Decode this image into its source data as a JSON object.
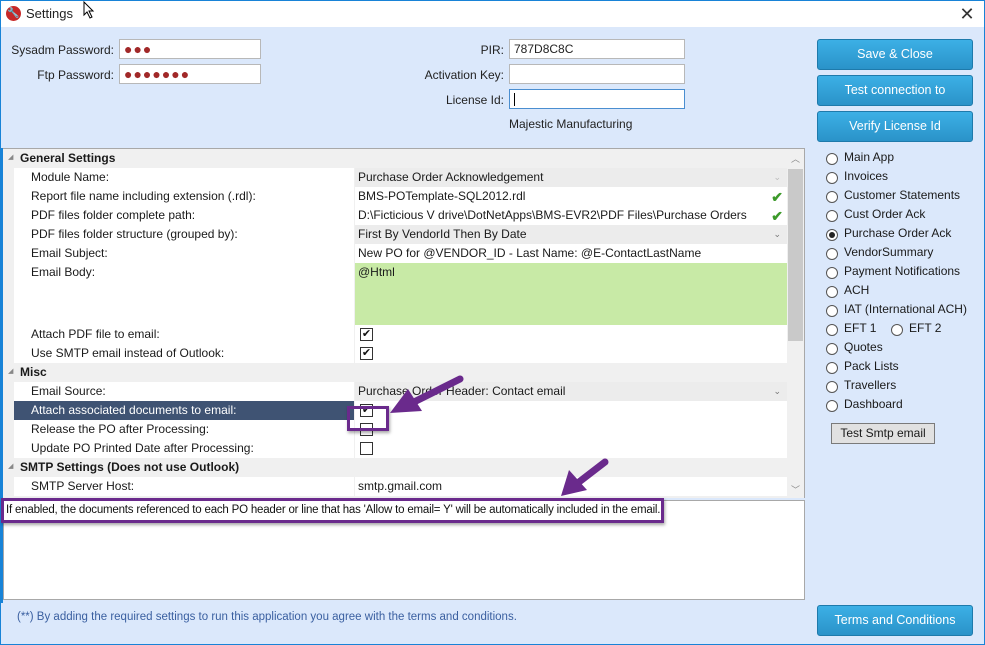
{
  "window": {
    "title": "Settings",
    "close_icon": "close-icon",
    "app_icon": "wrench-icon"
  },
  "credentials": {
    "sysadm_label": "Sysadm Password:",
    "sysadm_value": "●●●",
    "ftp_label": "Ftp Password:",
    "ftp_value": "●●●●●●●",
    "pir_label": "PIR:",
    "pir_value": "787D8C8C",
    "activation_label": "Activation Key:",
    "activation_value": "",
    "license_label": "License Id:",
    "license_value": "",
    "company_name": "Majestic Manufacturing"
  },
  "buttons": {
    "save_close": "Save & Close",
    "test_db": "Test connection to database",
    "verify_license": "Verify License Id",
    "test_smtp": "Test Smtp email",
    "terms": "Terms and Conditions"
  },
  "modules": {
    "selected": "Purchase Order Ack",
    "items": [
      {
        "label": "Main App",
        "checked": false
      },
      {
        "label": "Invoices",
        "checked": false
      },
      {
        "label": "Customer Statements",
        "checked": false
      },
      {
        "label": "Cust Order Ack",
        "checked": false
      },
      {
        "label": "Purchase Order Ack",
        "checked": true
      },
      {
        "label": "VendorSummary",
        "checked": false
      },
      {
        "label": "Payment Notifications",
        "checked": false
      },
      {
        "label": "ACH",
        "checked": false
      },
      {
        "label": "IAT (International ACH)",
        "checked": false
      },
      {
        "label": "EFT 1",
        "checked": false
      },
      {
        "label": "EFT 2",
        "checked": false
      },
      {
        "label": "Quotes",
        "checked": false
      },
      {
        "label": "Pack Lists",
        "checked": false
      },
      {
        "label": "Travellers",
        "checked": false
      },
      {
        "label": "Dashboard",
        "checked": false
      }
    ]
  },
  "property_grid": {
    "categories": [
      {
        "name": "General Settings",
        "rows": [
          {
            "label": "Module Name:",
            "value": "Purchase Order Acknowledgement",
            "type": "combo-disabled"
          },
          {
            "label": "Report file name including extension (.rdl):",
            "value": "BMS-POTemplate-SQL2012.rdl",
            "type": "validated"
          },
          {
            "label": "PDF files folder complete path:",
            "value": "D:\\Ficticious V drive\\DotNetApps\\BMS-EVR2\\PDF Files\\Purchase Orders",
            "type": "validated"
          },
          {
            "label": "PDF files folder structure (grouped by):",
            "value": "First By VendorId Then By Date",
            "type": "combo"
          },
          {
            "label": "Email Subject:",
            "value": "New PO for @VENDOR_ID - Last Name:  @E-ContactLastName",
            "type": "text"
          },
          {
            "label": "Email Body:",
            "value": "@Html",
            "type": "multiline"
          },
          {
            "label": "Attach PDF file to email:",
            "checked": true,
            "type": "checkbox"
          },
          {
            "label": "Use SMTP email instead of Outlook:",
            "checked": true,
            "type": "checkbox"
          }
        ]
      },
      {
        "name": "Misc",
        "rows": [
          {
            "label": "Email Source:",
            "value": "Purchase Order Header: Contact email",
            "type": "combo"
          },
          {
            "label": "Attach associated documents to email:",
            "checked": true,
            "type": "checkbox",
            "selected": true
          },
          {
            "label": "Release the PO after Processing:",
            "checked": false,
            "type": "checkbox"
          },
          {
            "label": "Update PO Printed Date after Processing:",
            "checked": false,
            "type": "checkbox"
          }
        ]
      },
      {
        "name": "SMTP Settings (Does not use Outlook)",
        "rows": [
          {
            "label": "SMTP Server Host:",
            "value": "smtp.gmail.com",
            "type": "text"
          }
        ]
      }
    ]
  },
  "description": "If enabled, the documents referenced to each PO header or line that has 'Allow to email= Y' will be automatically included in the email.",
  "footer_note": "(**) By adding the required settings to run this application you agree with the terms and conditions.",
  "colors": {
    "accent_button": "#2fa3da",
    "annotation": "#6a2a8c",
    "selected_row": "#3f5373",
    "email_body_bg": "#c8eaa6",
    "valid_check": "#3c9a2a"
  }
}
